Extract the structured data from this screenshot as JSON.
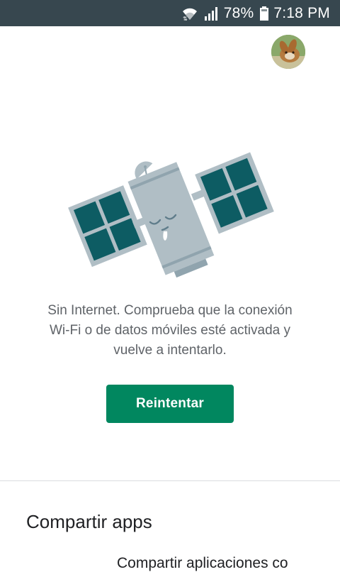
{
  "status_bar": {
    "battery_percent": "78%",
    "time": "7:18 PM",
    "icons": [
      "wifi-icon",
      "signal-icon",
      "battery-icon"
    ]
  },
  "header": {
    "avatar_icon": "account-avatar"
  },
  "error": {
    "illustration": "sleeping-satellite",
    "lines": [
      "Sin Internet. Comprueba que la conexión",
      "Wi-Fi o de datos móviles esté activada y",
      "vuelve a intentarlo."
    ],
    "retry_label": "Reintentar"
  },
  "section": {
    "title": "Compartir apps",
    "description": "Compartir aplicaciones co"
  },
  "colors": {
    "status_bar_bg": "#37474f",
    "accent": "#01875f",
    "panel": "#0d5c63",
    "body_grey": "#b0bec5"
  }
}
